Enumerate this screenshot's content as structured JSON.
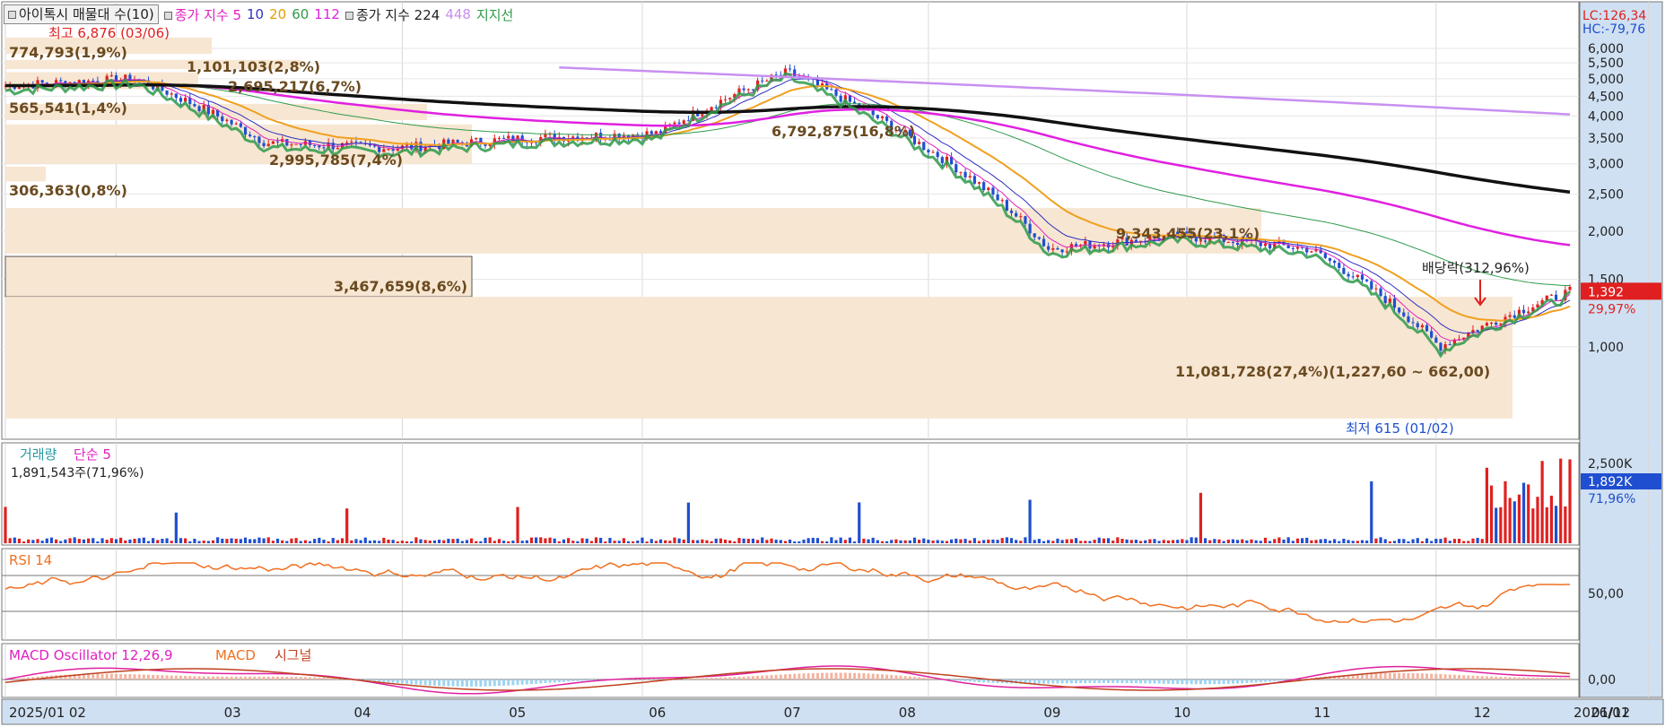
{
  "legend": {
    "vp_button": "아이톡시 매물대 수(10)",
    "ma_label": "종가 지수 5",
    "ma_periods": [
      "10",
      "20",
      "60",
      "112"
    ],
    "ma2_label": "종가 지수 224",
    "ma2_extra": "448",
    "support_label": "지지선"
  },
  "price_panel": {
    "lc": "LC:126,34",
    "hc": "HC:-79,76",
    "high_marker": "최고 6,876 (03/06)",
    "low_marker": "최저 615 (01/02)",
    "dividend": "배당락(312,96%)",
    "current_price": "1,392",
    "change_pct": "29,97%",
    "vp_labels": [
      "774,793(1,9%)",
      "1,101,103(2,8%)",
      "565,541(1,4%)",
      "2,695,217(6,7%)",
      "2,995,785(7,4%)",
      "306,363(0,8%)",
      "6,792,875(16,8%)",
      "9,343,455(23,1%)",
      "3,467,659(8,6%)",
      "11,081,728(27,4%)(1,227,60 ~ 662,00)"
    ],
    "y_ticks": [
      "6,000",
      "5,500",
      "5,000",
      "4,500",
      "4,000",
      "3,500",
      "3,000",
      "2,500",
      "2,000",
      "1,500",
      "1,000"
    ]
  },
  "volume_panel": {
    "title": "거래량",
    "ma_label": "단순 5",
    "current_text": "1,891,543주(71,96%)",
    "axis_label": "2,500K",
    "current_label": "1,892K",
    "pct_label": "71,96%"
  },
  "rsi_panel": {
    "title": "RSI 14",
    "axis_label": "50,00"
  },
  "macd_panel": {
    "title": "MACD Oscillator 12,26,9",
    "macd_label": "MACD",
    "signal_label": "시그널",
    "axis_label": "0,00"
  },
  "x_axis": [
    "2025/01",
    "02",
    "03",
    "04",
    "05",
    "06",
    "07",
    "08",
    "09",
    "10",
    "11",
    "12",
    "2026/01",
    "01/12"
  ],
  "colors": {
    "up": "#e02020",
    "down": "#1f4fd0",
    "ma5": "#e020c0",
    "ma10": "#3030c0",
    "ma20": "#f0a020",
    "ma60": "#2e9a4a",
    "ma112": "#e020e0",
    "ma224": "#111111",
    "ma448": "#c890f0",
    "vp": "#f7e6d2",
    "rsi": "#f07020",
    "macd_line": "#e020a0",
    "macd_sig": "#c04020"
  },
  "chart_data": {
    "type": "candlestick",
    "x_range": [
      "2025/01",
      "2026/01"
    ],
    "price_range": [
      615,
      6876
    ],
    "price_y_scale": "log",
    "monthly_close_approx": [
      {
        "month": "2025/01",
        "value": 4800
      },
      {
        "month": "2025/02",
        "value": 5000
      },
      {
        "month": "2025/03",
        "value": 3400
      },
      {
        "month": "2025/04",
        "value": 3300
      },
      {
        "month": "2025/05",
        "value": 3500
      },
      {
        "month": "2025/06",
        "value": 3600
      },
      {
        "month": "2025/07",
        "value": 5200
      },
      {
        "month": "2025/08",
        "value": 3400
      },
      {
        "month": "2025/09",
        "value": 1800
      },
      {
        "month": "2025/10",
        "value": 1950
      },
      {
        "month": "2025/11",
        "value": 1800
      },
      {
        "month": "2025/12",
        "value": 1000
      },
      {
        "month": "2026/01",
        "value": 1392
      }
    ],
    "high": {
      "value": 6876,
      "date": "03/06"
    },
    "low": {
      "value": 615,
      "date": "01/02"
    },
    "last_close": 1392,
    "change_pct": 29.97,
    "volume_last": 1891543,
    "volume_pct": 71.96,
    "rsi_levels": [
      30,
      70
    ],
    "rsi_last": 56
  }
}
